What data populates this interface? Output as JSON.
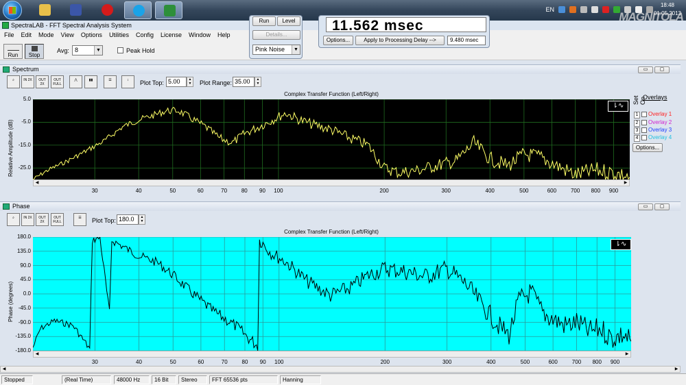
{
  "taskbar": {
    "apps": [
      {
        "name": "start-orb"
      },
      {
        "name": "explorer",
        "color": "#e8c04a"
      },
      {
        "name": "save",
        "color": "#3b56a8"
      },
      {
        "name": "opera",
        "color": "#d41b1b"
      },
      {
        "name": "skype",
        "color": "#1aa3e8"
      },
      {
        "name": "spectralab",
        "color": "#2d8f3a"
      }
    ],
    "lang": "EN",
    "clock_time": "18:48",
    "clock_date": "01.05.2013",
    "watermark": "MAGNITOLA"
  },
  "window": {
    "title": "SpectraLAB - FFT Spectral Analysis System"
  },
  "menu": [
    "File",
    "Edit",
    "Mode",
    "View",
    "Options",
    "Utilities",
    "Config",
    "License",
    "Window",
    "Help"
  ],
  "toolbar": {
    "run_label": "Run",
    "stop_label": "Stop",
    "avg_label": "Avg:",
    "avg_value": "8",
    "peak_hold_label": "Peak Hold"
  },
  "generator": {
    "run_label": "Run",
    "level_label": "Level",
    "details_label": "Details...",
    "signal_value": "Pink Noise"
  },
  "delay": {
    "readout": "11.562 msec",
    "options_label": "Options...",
    "apply_label": "Apply to Processing Delay -->",
    "applied_value": "9.480 msec"
  },
  "spectrum": {
    "panel_title": "Spectrum",
    "plot_top_label": "Plot Top:",
    "plot_top_value": "5.00",
    "plot_range_label": "Plot Range:",
    "plot_range_value": "35.00",
    "caption": "Complex Transfer Function (Left/Right)",
    "ylabel": "Relative Amplitude (dB)",
    "bg_color": "#000000",
    "line_color": "#ffff66",
    "grid_color": "#1f6b1f",
    "overlays_title": "Overlays",
    "set_label": "Set",
    "on_label": "On",
    "overlays": [
      {
        "num": "1",
        "label": "Overlay 1",
        "color": "#ff2020"
      },
      {
        "num": "2",
        "label": "Overlay 2",
        "color": "#d020d0"
      },
      {
        "num": "3",
        "label": "Overlay 3",
        "color": "#2040ff"
      },
      {
        "num": "4",
        "label": "Overlay 4",
        "color": "#20c0e0"
      }
    ],
    "options_label": "Options..."
  },
  "phase": {
    "panel_title": "Phase",
    "plot_top_label": "Plot Top:",
    "plot_top_value": "180.0",
    "caption": "Complex Transfer Function (Left/Right)",
    "ylabel": "Phase (degrees)",
    "bg_color": "#00ffff",
    "line_color": "#000000",
    "grid_color": "#2a9a9a"
  },
  "chart_data": [
    {
      "type": "line",
      "title": "Complex Transfer Function (Left/Right)",
      "xlabel": "",
      "ylabel": "Relative Amplitude (dB)",
      "x_scale": "log",
      "xlim": [
        20,
        1000
      ],
      "ylim": [
        -30,
        5
      ],
      "y_ticks": [
        "5.0",
        "-5.0",
        "-15.0",
        "-25.0"
      ],
      "y_tick_values": [
        5,
        -5,
        -15,
        -25
      ],
      "x_ticks": [
        "30",
        "40",
        "50",
        "60",
        "70",
        "80",
        "90",
        "100",
        "200",
        "300",
        "400",
        "500",
        "600",
        "700",
        "800",
        "900"
      ],
      "x_tick_values": [
        30,
        40,
        50,
        60,
        70,
        80,
        90,
        100,
        200,
        300,
        400,
        500,
        600,
        700,
        800,
        900
      ],
      "grid": true,
      "series": [
        {
          "x": [
            20,
            22,
            25,
            28,
            32,
            36,
            40,
            44,
            48,
            52,
            56,
            62,
            68,
            74,
            80,
            88,
            96,
            105,
            115,
            125,
            140,
            160,
            180,
            200,
            220,
            250,
            280,
            320,
            360,
            400,
            450,
            500,
            550,
            620,
            700,
            800,
            900,
            1000
          ],
          "y": [
            -30,
            -26,
            -22,
            -18,
            -13,
            -7,
            -4,
            -2,
            0,
            0,
            -3,
            -7,
            -12,
            -14,
            -10,
            -7,
            -4,
            -1,
            -4,
            -6,
            -8,
            -12,
            -15,
            -25,
            -27,
            -26,
            -24,
            -22,
            -14,
            -21,
            -24,
            -19,
            -20,
            -24,
            -28,
            -26,
            -27,
            -29
          ]
        }
      ]
    },
    {
      "type": "line",
      "title": "Complex Transfer Function (Left/Right)",
      "xlabel": "",
      "ylabel": "Phase (degrees)",
      "x_scale": "log",
      "xlim": [
        20,
        1000
      ],
      "ylim": [
        -180,
        180
      ],
      "y_ticks": [
        "180.0",
        "135.0",
        "90.0",
        "45.0",
        "0.0",
        "-45.0",
        "-90.0",
        "-135.0",
        "-180.0"
      ],
      "y_tick_values": [
        180,
        135,
        90,
        45,
        0,
        -45,
        -90,
        -135,
        -180
      ],
      "x_ticks": [
        "30",
        "40",
        "50",
        "60",
        "70",
        "80",
        "90",
        "100",
        "200",
        "300",
        "400",
        "500",
        "600",
        "700",
        "800",
        "900"
      ],
      "x_tick_values": [
        30,
        40,
        50,
        60,
        70,
        80,
        90,
        100,
        200,
        300,
        400,
        500,
        600,
        700,
        800,
        900
      ],
      "grid": true,
      "series": [
        {
          "x": [
            20,
            21,
            23,
            26,
            28,
            29,
            29.5,
            31,
            33,
            33.5,
            36,
            40,
            45,
            50,
            57,
            65,
            75,
            82,
            87,
            88,
            90,
            95,
            105,
            120,
            140,
            160,
            180,
            200,
            230,
            260,
            300,
            340,
            380,
            420,
            450,
            480,
            520,
            560,
            600,
            650,
            700,
            760,
            820,
            880,
            950,
            1000
          ],
          "y": [
            -170,
            -110,
            -85,
            -100,
            -150,
            -175,
            170,
            178,
            -60,
            170,
            150,
            120,
            100,
            60,
            0,
            -55,
            -100,
            -140,
            -165,
            170,
            160,
            130,
            100,
            40,
            -5,
            20,
            60,
            80,
            70,
            55,
            80,
            30,
            -40,
            -100,
            -130,
            -20,
            5,
            -60,
            -80,
            -100,
            -90,
            -120,
            -110,
            -140,
            -130,
            -150
          ]
        }
      ]
    }
  ],
  "status": [
    {
      "label": "Stopped"
    },
    {
      "label": "(Real Time)"
    },
    {
      "label": "48000 Hz"
    },
    {
      "label": "16 Bit"
    },
    {
      "label": "Stereo"
    },
    {
      "label": "FFT 65536 pts"
    },
    {
      "label": "Hanning"
    }
  ]
}
